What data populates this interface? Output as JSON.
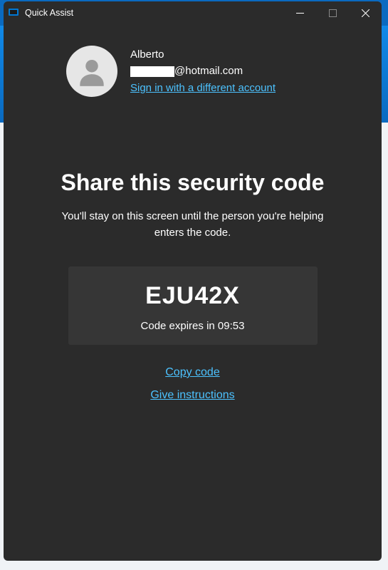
{
  "titlebar": {
    "title": "Quick Assist"
  },
  "account": {
    "name": "Alberto",
    "email_suffix": "@hotmail.com",
    "switch_link": "Sign in with a different account"
  },
  "main": {
    "heading": "Share this security code",
    "subhead": "You'll stay on this screen until the person you're helping enters the code."
  },
  "code": {
    "value": "EJU42X",
    "expiry_prefix": "Code expires in ",
    "expiry_time": "09:53"
  },
  "actions": {
    "copy": "Copy code",
    "instructions": "Give instructions"
  }
}
